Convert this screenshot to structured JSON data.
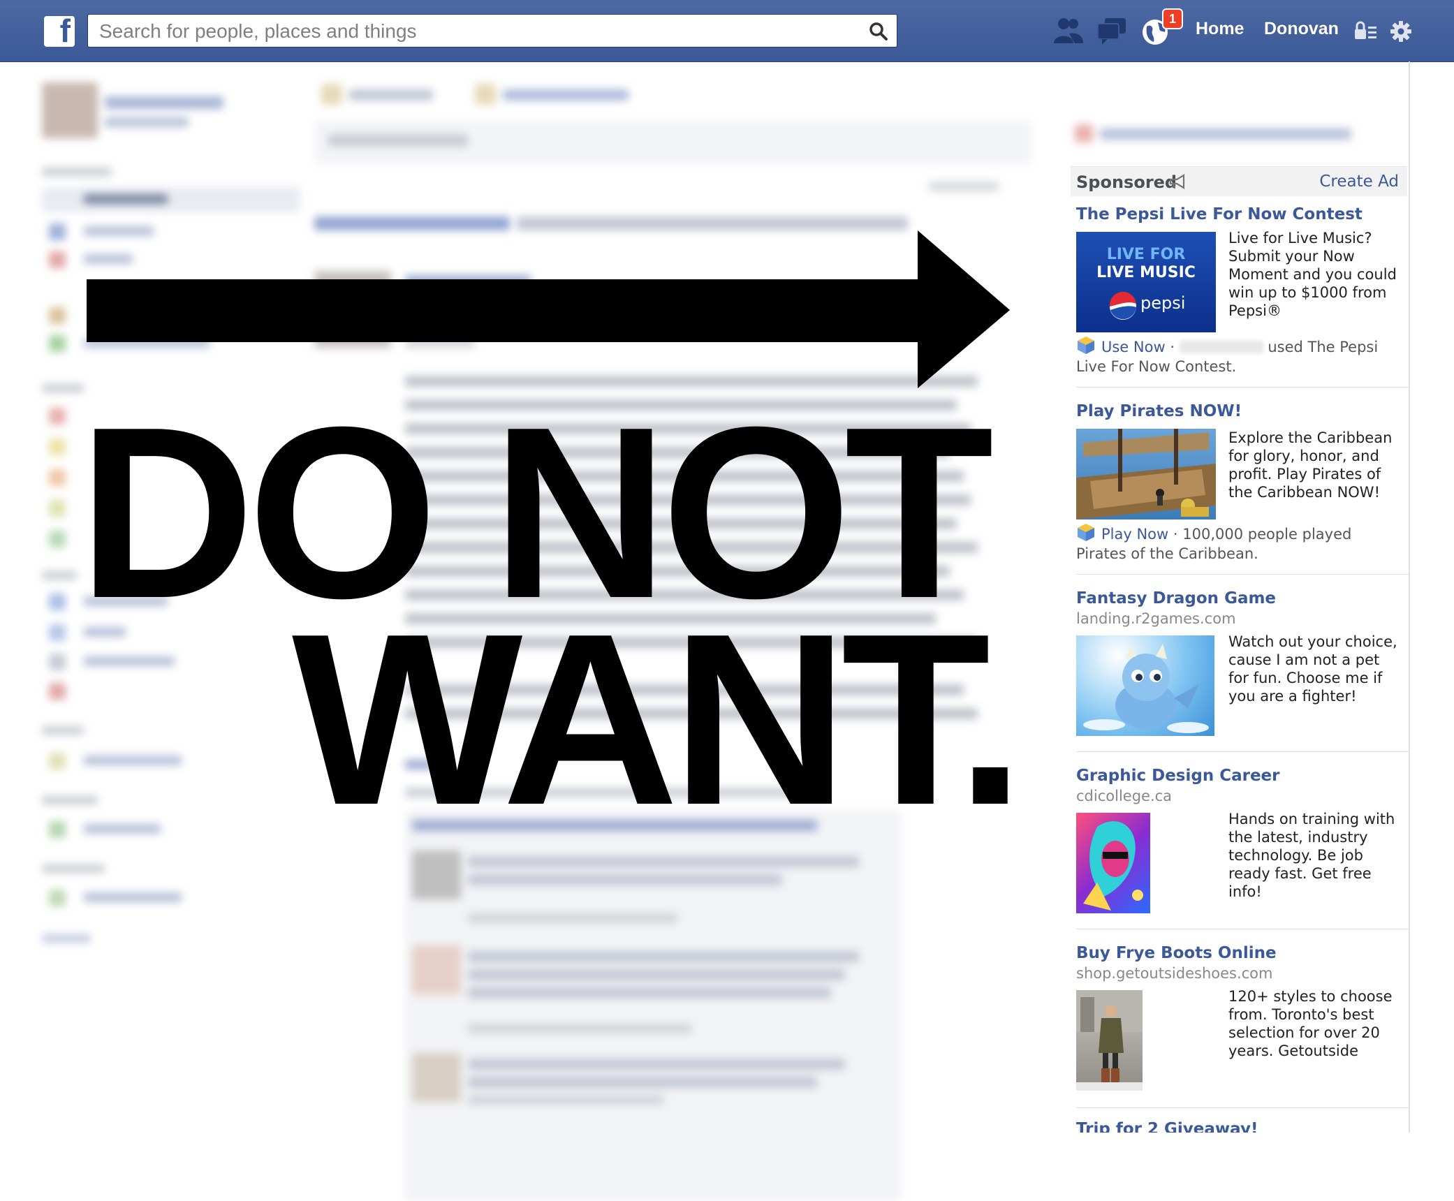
{
  "topbar": {
    "logo_letter": "f",
    "search_placeholder": "Search for people, places and things",
    "notification_count": "1",
    "nav_home": "Home",
    "nav_profile": "Donovan",
    "icons": [
      "friend-requests-icon",
      "messages-icon",
      "notifications-globe-icon",
      "privacy-shortcuts-icon",
      "settings-gear-icon"
    ]
  },
  "sponsored": {
    "label": "Sponsored",
    "create_ad": "Create Ad",
    "ads": [
      {
        "title": "The Pepsi Live For Now Contest",
        "image_text_line1": "LIVE FOR",
        "image_text_line2": "LIVE MUSIC",
        "image_brand": "pepsi",
        "body": "Live for Live Music? Submit your Now Moment and you could win up to $1000 from Pepsi®",
        "cta": "Use Now",
        "social": "used The Pepsi Live For Now Contest."
      },
      {
        "title": "Play Pirates NOW!",
        "body": "Explore the Caribbean for glory, honor, and profit. Play Pirates of the Caribbean NOW!",
        "cta": "Play Now",
        "social": "100,000 people played Pirates of the Caribbean."
      },
      {
        "title": "Fantasy Dragon Game",
        "url": "landing.r2games.com",
        "body": "Watch out your choice, cause I am not a pet for fun. Choose me if you are a fighter!"
      },
      {
        "title": "Graphic Design Career",
        "url": "cdicollege.ca",
        "body": "Hands on training with the latest, industry technology. Be job ready fast. Get free info!"
      },
      {
        "title": "Buy Frye Boots Online",
        "url": "shop.getoutsideshoes.com",
        "body": "120+ styles to choose from. Toronto's best selection for over 20 years. Getoutside"
      },
      {
        "title": "Trip for 2 Giveaway!"
      }
    ]
  },
  "overlay": {
    "line1": "DO NOT",
    "line2": "WANT."
  },
  "colors": {
    "facebook_blue": "#3b5998",
    "topbar_top": "#4e69a2",
    "badge_red": "#f03d25",
    "overlay_black": "#000000"
  }
}
